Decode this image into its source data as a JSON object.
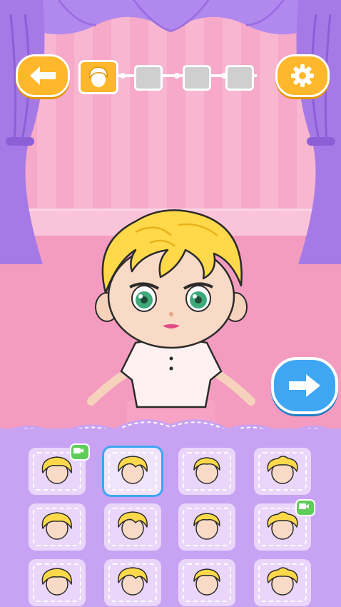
{
  "colors": {
    "accent": "#ffb72b",
    "next": "#3ea6f2",
    "panel": "#c8a2f3",
    "curtain": "#a67ae6",
    "wall": "#f8b6d1"
  },
  "header": {
    "back_icon": "arrow-left-icon",
    "settings_icon": "gear-icon"
  },
  "progress": {
    "current_step": 1,
    "total_steps": 4,
    "step_icons": [
      "hair-icon",
      "",
      "",
      ""
    ]
  },
  "next_button": {
    "icon": "arrow-right-icon"
  },
  "hair_options": [
    {
      "icon": "hairstyle-1-icon",
      "locked_video": true,
      "selected": false
    },
    {
      "icon": "hairstyle-2-icon",
      "locked_video": false,
      "selected": true
    },
    {
      "icon": "hairstyle-3-icon",
      "locked_video": false,
      "selected": false
    },
    {
      "icon": "hairstyle-4-icon",
      "locked_video": false,
      "selected": false
    },
    {
      "icon": "hairstyle-5-icon",
      "locked_video": false,
      "selected": false
    },
    {
      "icon": "hairstyle-6-icon",
      "locked_video": false,
      "selected": false
    },
    {
      "icon": "hairstyle-7-icon",
      "locked_video": false,
      "selected": false
    },
    {
      "icon": "hairstyle-8-icon",
      "locked_video": true,
      "selected": false
    },
    {
      "icon": "hairstyle-9-icon",
      "locked_video": false,
      "selected": false
    },
    {
      "icon": "hairstyle-10-icon",
      "locked_video": false,
      "selected": false
    },
    {
      "icon": "hairstyle-11-icon",
      "locked_video": false,
      "selected": false
    },
    {
      "icon": "hairstyle-12-icon",
      "locked_video": false,
      "selected": false
    }
  ]
}
